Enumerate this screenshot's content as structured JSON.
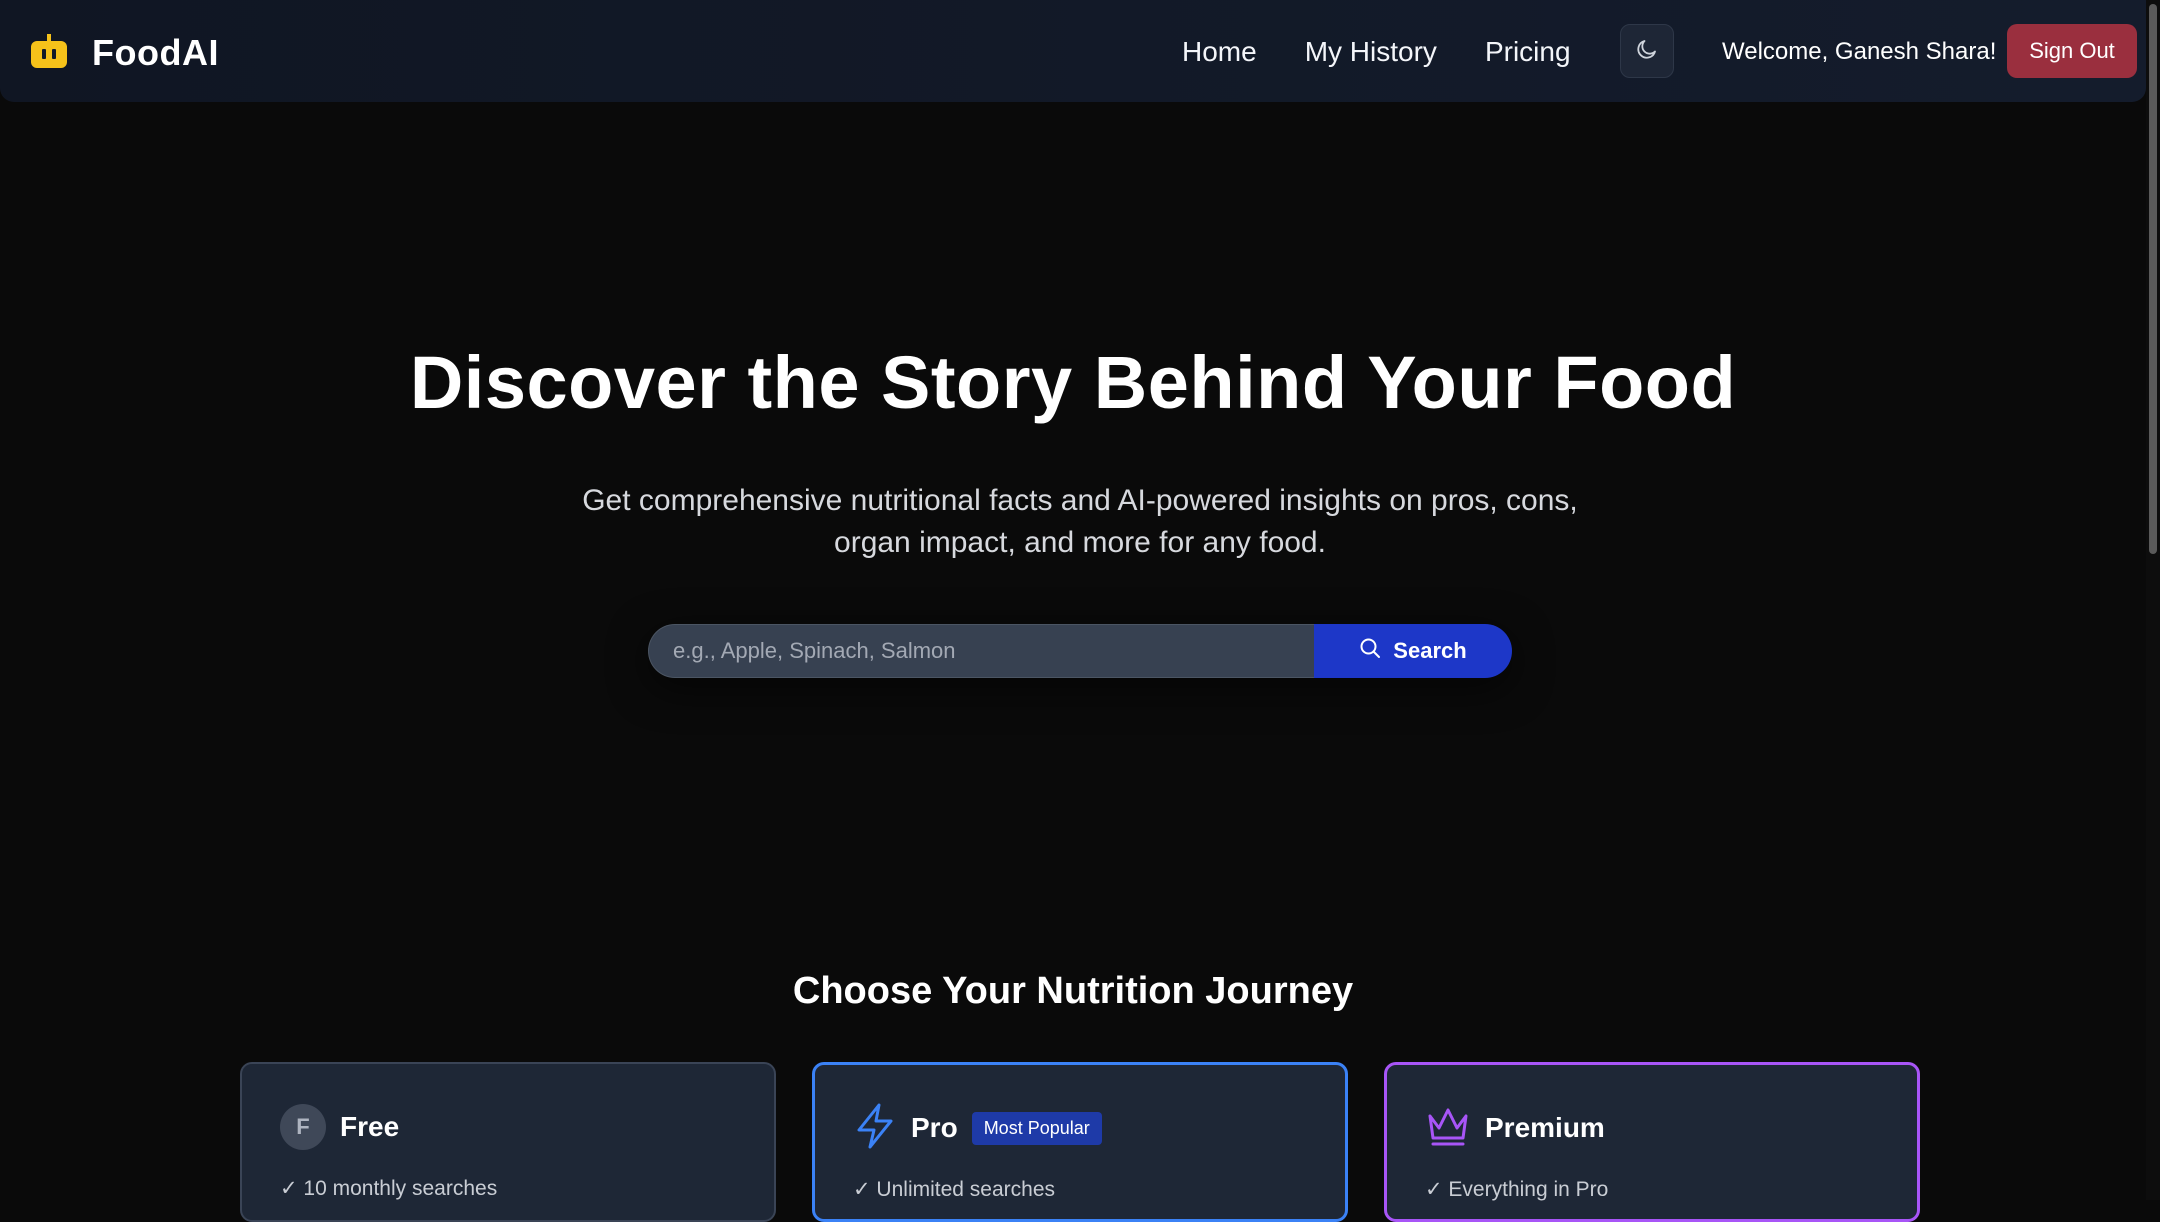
{
  "header": {
    "brand": "FoodAI",
    "nav": {
      "home": "Home",
      "history": "My History",
      "pricing": "Pricing"
    },
    "theme_icon": "moon-icon",
    "welcome": "Welcome, Ganesh Shara!",
    "sign_out": "Sign Out"
  },
  "hero": {
    "title": "Discover the Story Behind Your Food",
    "subtitle_line1": "Get comprehensive nutritional facts and AI-powered insights on pros, cons,",
    "subtitle_line2": "organ impact, and more for any food.",
    "search_placeholder": "e.g., Apple, Spinach, Salmon",
    "search_value": "",
    "search_button": "Search"
  },
  "plans": {
    "title": "Choose Your Nutrition Journey",
    "items": [
      {
        "name": "Free",
        "avatar": "F",
        "feature": "✓ 10 monthly searches"
      },
      {
        "name": "Pro",
        "badge": "Most Popular",
        "icon": "lightning-icon",
        "feature": "✓ Unlimited searches"
      },
      {
        "name": "Premium",
        "icon": "crown-icon",
        "feature": "✓ Everything in Pro"
      }
    ]
  },
  "colors": {
    "background": "#0a0a0a",
    "header": "#121a28",
    "accent_blue": "#1d37c8",
    "sign_out": "#9a2f3e",
    "pro_border": "#3b82f6",
    "premium_border": "#a855f7",
    "logo_yellow": "#f6c21a"
  }
}
